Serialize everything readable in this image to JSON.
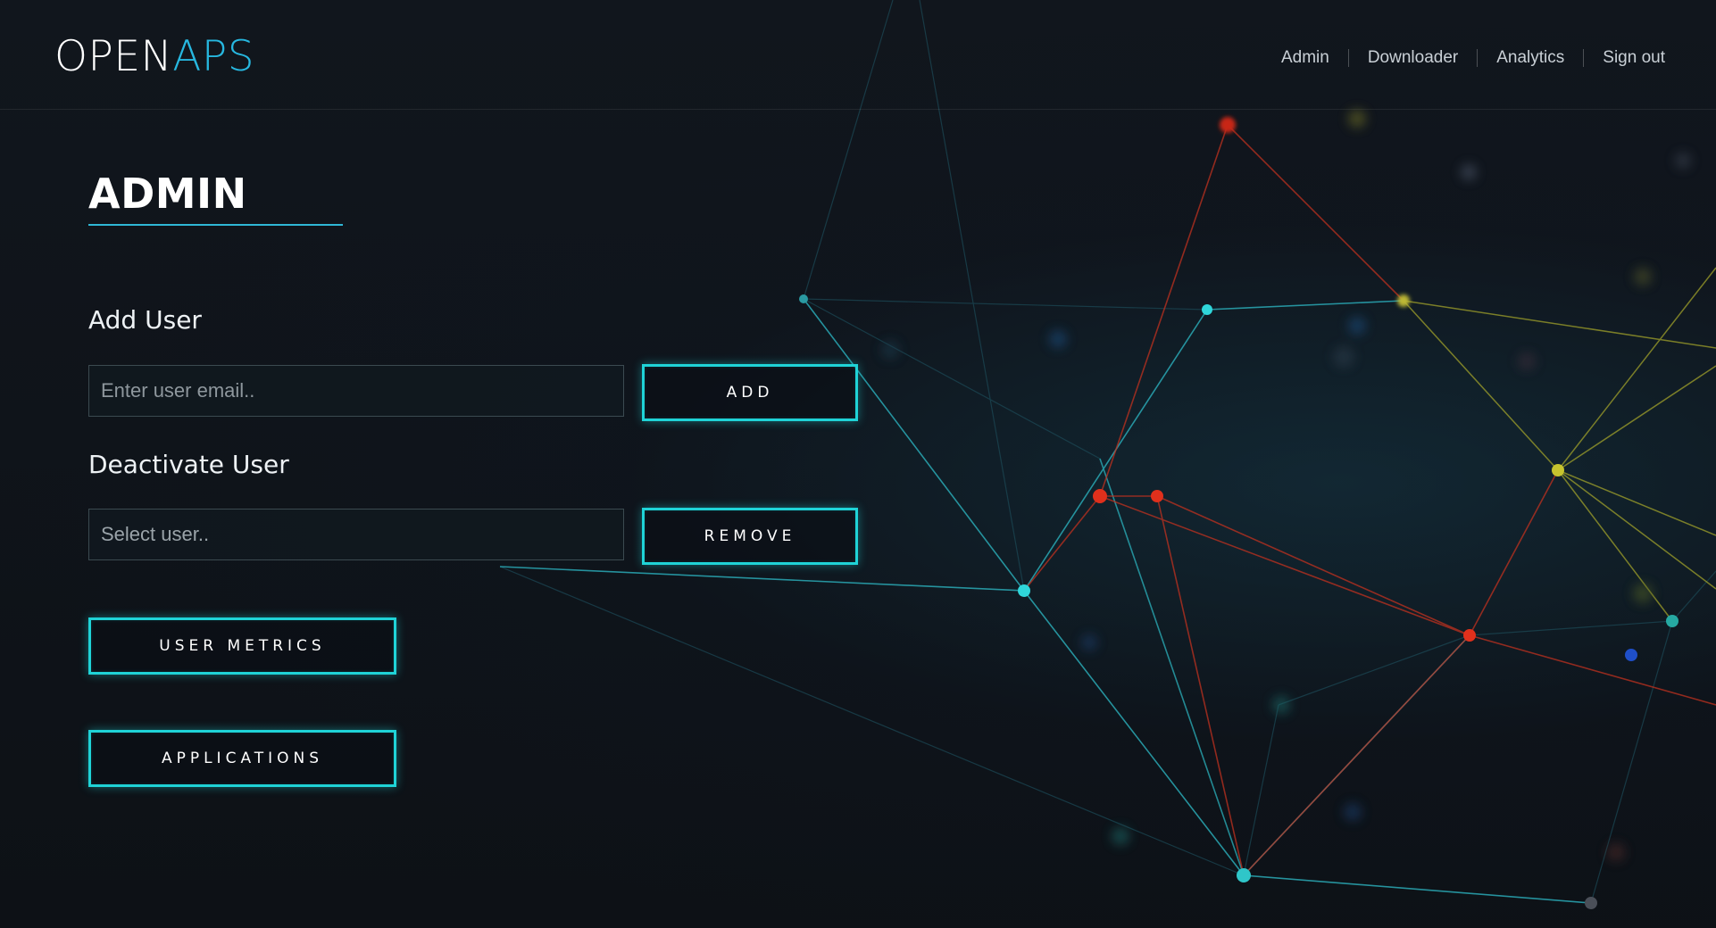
{
  "header": {
    "logo_part1": "OPEN",
    "logo_part2": "APS",
    "nav": [
      {
        "label": "Admin"
      },
      {
        "label": "Downloader"
      },
      {
        "label": "Analytics"
      },
      {
        "label": "Sign out"
      }
    ]
  },
  "main": {
    "title": "ADMIN",
    "add_user": {
      "label": "Add User",
      "placeholder": "Enter user email..",
      "button_label": "ADD"
    },
    "deactivate_user": {
      "label": "Deactivate User",
      "placeholder": "Select user..",
      "button_label": "REMOVE"
    },
    "user_metrics_label": "USER METRICS",
    "applications_label": "APPLICATIONS"
  },
  "colors": {
    "accent_cyan": "#1fd3d7",
    "logo_blue": "#27b8e0",
    "background": "#0e1218"
  }
}
